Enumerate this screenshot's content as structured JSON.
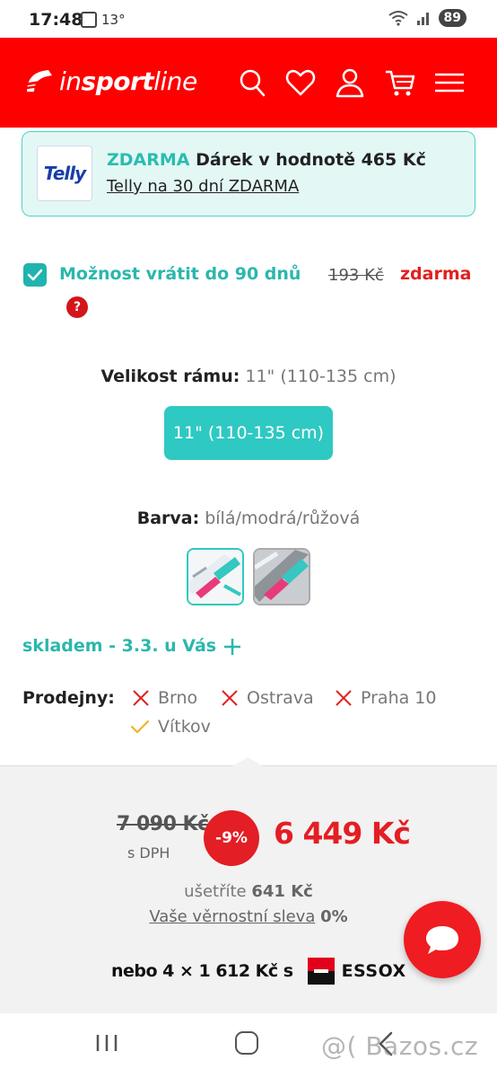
{
  "status_bar": {
    "time": "17:48",
    "temperature": "13°",
    "battery": "89"
  },
  "header": {
    "logo": {
      "part1": "in",
      "part2": "sport",
      "part3": "line"
    },
    "brand_color": "#fe0000"
  },
  "telly_banner": {
    "logo_text": "Telly",
    "free_word": "ZDARMA",
    "gift_text": "Dárek v hodnotě 465 Kč",
    "link_text": "Telly na 30 dní ZDARMA"
  },
  "return_option": {
    "checked": true,
    "label": "Možnost vrátit do 90 dnů",
    "old_price": "193 Kč",
    "price": "zdarma",
    "help": "?"
  },
  "frame_size": {
    "label": "Velikost rámu:",
    "value": "11\" (110-135 cm)",
    "options": [
      "11\" (110-135 cm)"
    ]
  },
  "color": {
    "label": "Barva:",
    "value": "bílá/modrá/růžová"
  },
  "stock": {
    "text": "skladem - 3.3. u Vás"
  },
  "stores": {
    "label": "Prodejny:",
    "items": [
      {
        "name": "Brno",
        "available": false
      },
      {
        "name": "Ostrava",
        "available": false
      },
      {
        "name": "Praha 10",
        "available": false
      },
      {
        "name": "Vítkov",
        "available": true
      }
    ]
  },
  "price": {
    "old_price": "7 090 Kč",
    "tax_note": "s DPH",
    "discount": "-9%",
    "new_price": "6 449 Kč",
    "save_label": "ušetříte",
    "save_value": "641 Kč",
    "loyalty_label": "Vaše věrnostní sleva",
    "loyalty_value": "0%",
    "installment_text": "nebo 4 × 1 612 Kč s",
    "installment_provider": "ESSOX",
    "accent_color": "#e31e24"
  },
  "watermark": "@( Bazos.cz"
}
